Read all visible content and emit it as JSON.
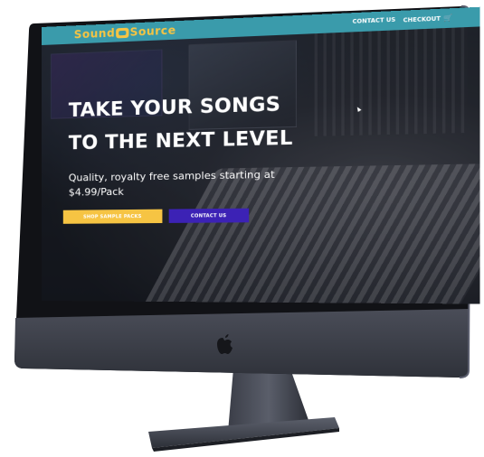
{
  "site": {
    "brand_left": "Sound",
    "brand_right": "Source",
    "brand_logo_icon": "music-note-icon",
    "nav": {
      "contact_label": "CONTACT US",
      "checkout_label": "CHECKOUT",
      "cart_icon": "cart-icon"
    },
    "hero": {
      "title": "TAKE YOUR SONGS TO THE NEXT LEVEL",
      "subtitle": "Quality, royalty free samples starting at $4.99/Pack",
      "primary_button": "SHOP SAMPLE PACKS",
      "secondary_button": "CONTACT US"
    }
  },
  "colors": {
    "navbar": "#3a9bab",
    "brand": "#f6c443",
    "primary_button": "#f6c443",
    "secondary_button": "#3c22b5",
    "monitor_frame": "#2a2c33",
    "monitor_chin": "#3a3d46"
  },
  "device": {
    "logo_icon": "apple-logo-icon"
  }
}
